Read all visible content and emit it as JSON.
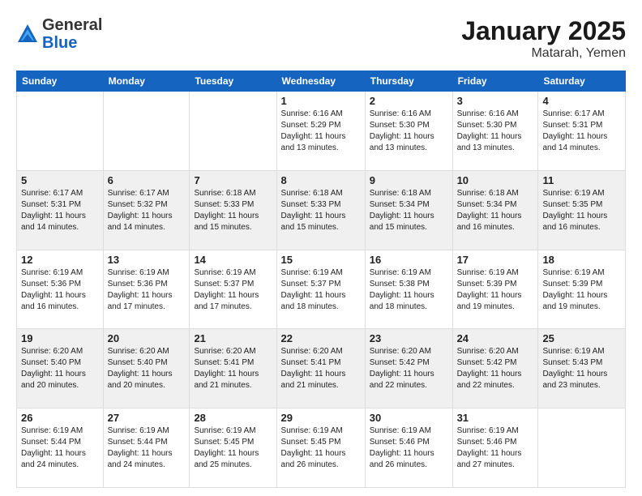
{
  "header": {
    "logo_general": "General",
    "logo_blue": "Blue",
    "month": "January 2025",
    "location": "Matarah, Yemen"
  },
  "days_of_week": [
    "Sunday",
    "Monday",
    "Tuesday",
    "Wednesday",
    "Thursday",
    "Friday",
    "Saturday"
  ],
  "weeks": [
    [
      {
        "num": "",
        "info": ""
      },
      {
        "num": "",
        "info": ""
      },
      {
        "num": "",
        "info": ""
      },
      {
        "num": "1",
        "info": "Sunrise: 6:16 AM\nSunset: 5:29 PM\nDaylight: 11 hours\nand 13 minutes."
      },
      {
        "num": "2",
        "info": "Sunrise: 6:16 AM\nSunset: 5:30 PM\nDaylight: 11 hours\nand 13 minutes."
      },
      {
        "num": "3",
        "info": "Sunrise: 6:16 AM\nSunset: 5:30 PM\nDaylight: 11 hours\nand 13 minutes."
      },
      {
        "num": "4",
        "info": "Sunrise: 6:17 AM\nSunset: 5:31 PM\nDaylight: 11 hours\nand 14 minutes."
      }
    ],
    [
      {
        "num": "5",
        "info": "Sunrise: 6:17 AM\nSunset: 5:31 PM\nDaylight: 11 hours\nand 14 minutes."
      },
      {
        "num": "6",
        "info": "Sunrise: 6:17 AM\nSunset: 5:32 PM\nDaylight: 11 hours\nand 14 minutes."
      },
      {
        "num": "7",
        "info": "Sunrise: 6:18 AM\nSunset: 5:33 PM\nDaylight: 11 hours\nand 15 minutes."
      },
      {
        "num": "8",
        "info": "Sunrise: 6:18 AM\nSunset: 5:33 PM\nDaylight: 11 hours\nand 15 minutes."
      },
      {
        "num": "9",
        "info": "Sunrise: 6:18 AM\nSunset: 5:34 PM\nDaylight: 11 hours\nand 15 minutes."
      },
      {
        "num": "10",
        "info": "Sunrise: 6:18 AM\nSunset: 5:34 PM\nDaylight: 11 hours\nand 16 minutes."
      },
      {
        "num": "11",
        "info": "Sunrise: 6:19 AM\nSunset: 5:35 PM\nDaylight: 11 hours\nand 16 minutes."
      }
    ],
    [
      {
        "num": "12",
        "info": "Sunrise: 6:19 AM\nSunset: 5:36 PM\nDaylight: 11 hours\nand 16 minutes."
      },
      {
        "num": "13",
        "info": "Sunrise: 6:19 AM\nSunset: 5:36 PM\nDaylight: 11 hours\nand 17 minutes."
      },
      {
        "num": "14",
        "info": "Sunrise: 6:19 AM\nSunset: 5:37 PM\nDaylight: 11 hours\nand 17 minutes."
      },
      {
        "num": "15",
        "info": "Sunrise: 6:19 AM\nSunset: 5:37 PM\nDaylight: 11 hours\nand 18 minutes."
      },
      {
        "num": "16",
        "info": "Sunrise: 6:19 AM\nSunset: 5:38 PM\nDaylight: 11 hours\nand 18 minutes."
      },
      {
        "num": "17",
        "info": "Sunrise: 6:19 AM\nSunset: 5:39 PM\nDaylight: 11 hours\nand 19 minutes."
      },
      {
        "num": "18",
        "info": "Sunrise: 6:19 AM\nSunset: 5:39 PM\nDaylight: 11 hours\nand 19 minutes."
      }
    ],
    [
      {
        "num": "19",
        "info": "Sunrise: 6:20 AM\nSunset: 5:40 PM\nDaylight: 11 hours\nand 20 minutes."
      },
      {
        "num": "20",
        "info": "Sunrise: 6:20 AM\nSunset: 5:40 PM\nDaylight: 11 hours\nand 20 minutes."
      },
      {
        "num": "21",
        "info": "Sunrise: 6:20 AM\nSunset: 5:41 PM\nDaylight: 11 hours\nand 21 minutes."
      },
      {
        "num": "22",
        "info": "Sunrise: 6:20 AM\nSunset: 5:41 PM\nDaylight: 11 hours\nand 21 minutes."
      },
      {
        "num": "23",
        "info": "Sunrise: 6:20 AM\nSunset: 5:42 PM\nDaylight: 11 hours\nand 22 minutes."
      },
      {
        "num": "24",
        "info": "Sunrise: 6:20 AM\nSunset: 5:42 PM\nDaylight: 11 hours\nand 22 minutes."
      },
      {
        "num": "25",
        "info": "Sunrise: 6:19 AM\nSunset: 5:43 PM\nDaylight: 11 hours\nand 23 minutes."
      }
    ],
    [
      {
        "num": "26",
        "info": "Sunrise: 6:19 AM\nSunset: 5:44 PM\nDaylight: 11 hours\nand 24 minutes."
      },
      {
        "num": "27",
        "info": "Sunrise: 6:19 AM\nSunset: 5:44 PM\nDaylight: 11 hours\nand 24 minutes."
      },
      {
        "num": "28",
        "info": "Sunrise: 6:19 AM\nSunset: 5:45 PM\nDaylight: 11 hours\nand 25 minutes."
      },
      {
        "num": "29",
        "info": "Sunrise: 6:19 AM\nSunset: 5:45 PM\nDaylight: 11 hours\nand 26 minutes."
      },
      {
        "num": "30",
        "info": "Sunrise: 6:19 AM\nSunset: 5:46 PM\nDaylight: 11 hours\nand 26 minutes."
      },
      {
        "num": "31",
        "info": "Sunrise: 6:19 AM\nSunset: 5:46 PM\nDaylight: 11 hours\nand 27 minutes."
      },
      {
        "num": "",
        "info": ""
      }
    ]
  ]
}
